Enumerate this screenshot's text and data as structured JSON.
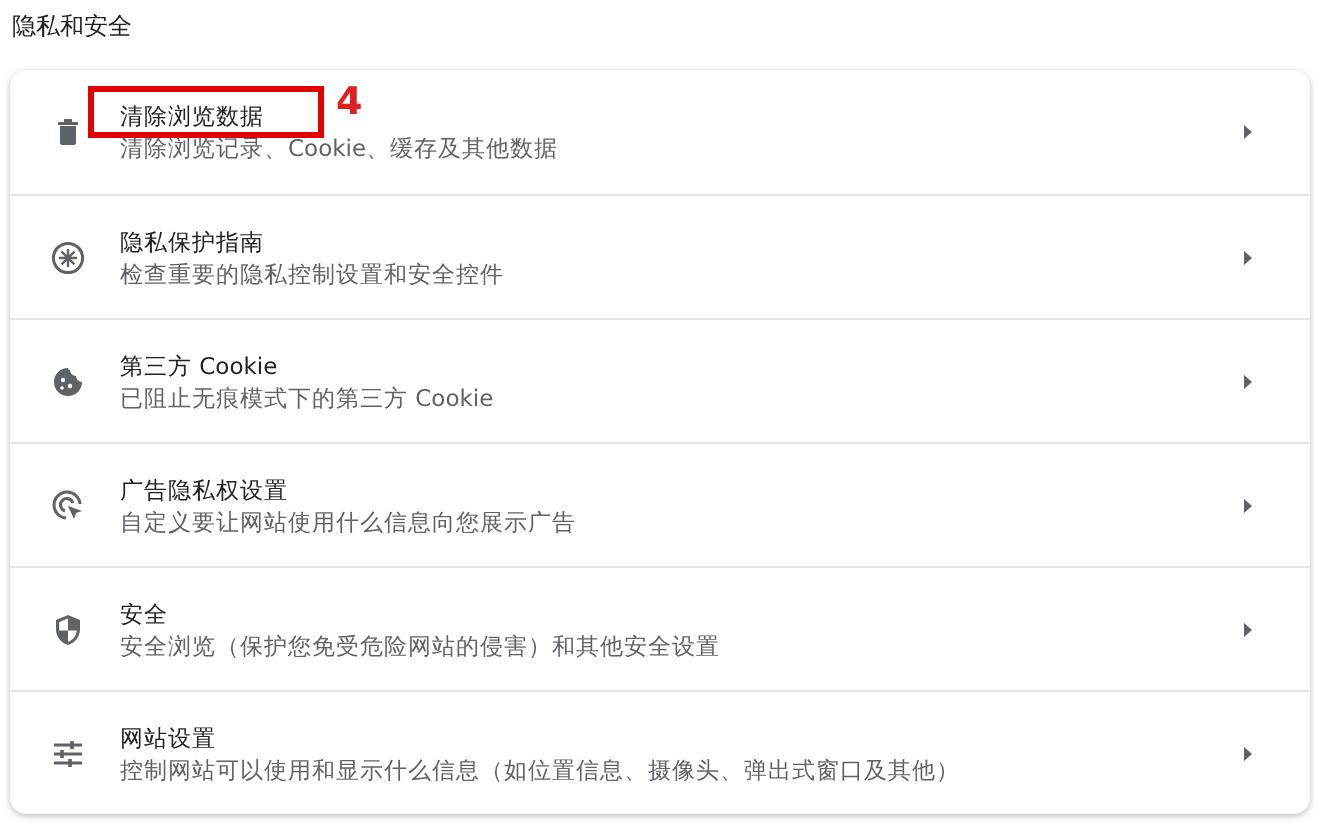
{
  "section_title": "隐私和安全",
  "items": [
    {
      "kind": "trash",
      "title": "清除浏览数据",
      "description": "清除浏览记录、Cookie、缓存及其他数据",
      "highlighted": true,
      "callout": "4"
    },
    {
      "kind": "guide",
      "title": "隐私保护指南",
      "description": "检查重要的隐私控制设置和安全控件",
      "highlighted": false
    },
    {
      "kind": "cookie",
      "title": "第三方 Cookie",
      "description": "已阻止无痕模式下的第三方 Cookie",
      "highlighted": false
    },
    {
      "kind": "ads",
      "title": "广告隐私权设置",
      "description": "自定义要让网站使用什么信息向您展示广告",
      "highlighted": false
    },
    {
      "kind": "shield",
      "title": "安全",
      "description": "安全浏览（保护您免受危险网站的侵害）和其他安全设置",
      "highlighted": false
    },
    {
      "kind": "sliders",
      "title": "网站设置",
      "description": "控制网站可以使用和显示什么信息（如位置信息、摄像头、弹出式窗口及其他）",
      "highlighted": false
    }
  ]
}
